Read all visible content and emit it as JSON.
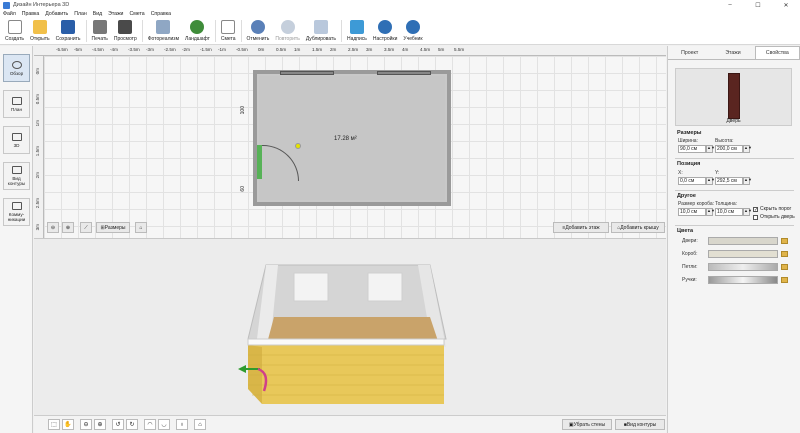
{
  "window": {
    "title": "Дизайн Интерьера 3D",
    "min": "–",
    "max": "☐",
    "close": "✕"
  },
  "menu": [
    "Файл",
    "Правка",
    "Добавить",
    "План",
    "Вид",
    "Этажи",
    "Смета",
    "Справка"
  ],
  "toolbar": {
    "create": "Создать",
    "open": "Открыть",
    "save": "Сохранить",
    "print": "Печать",
    "preview": "Просмотр",
    "photo": "Фотореализм",
    "landscape": "Ландшафт",
    "estimate": "Смета",
    "undo": "Отменить",
    "redo": "Повторить",
    "duplicate": "Дублировать",
    "labels": "Надпись",
    "settings": "Настройки",
    "tutorial": "Учебник"
  },
  "left_nav": {
    "overview": "Обзор",
    "plan": "План",
    "view3d": "3D",
    "outline": "Вид контуры",
    "comm": "Комму-никации"
  },
  "ruler": {
    "top": [
      "-5.5m",
      "-5m",
      "-4.5m",
      "-4m",
      "-3.5m",
      "-3m",
      "-2.5m",
      "-2m",
      "-1.5m",
      "-1m",
      "-0.5m",
      "0m",
      "0.5m",
      "1m",
      "1.5m",
      "2m",
      "2.5m",
      "3m",
      "3.5m",
      "4m",
      "4.5m",
      "5m",
      "5.5m"
    ],
    "left": [
      "0m",
      "0.5m",
      "1m",
      "1.5m",
      "2m",
      "2.5m",
      "3m"
    ]
  },
  "plan": {
    "area": "17.28 м²",
    "dim_top": "100",
    "dim_bottom": "60",
    "dims_label": "Размеры",
    "add_floor": "Добавить этаж",
    "add_roof": "Добавить крышу"
  },
  "bottom": {
    "hide_walls": "Убрать стены",
    "outline_view": "Вид контуры"
  },
  "panel": {
    "tabs": [
      "Проект",
      "Этажи",
      "Свойства"
    ],
    "active_tab": "Свойства",
    "item_name": "Дверь",
    "sizes_title": "Размеры",
    "width_label": "Ширина:",
    "width_value": "90,0 см",
    "height_label": "Высота:",
    "height_value": "200,0 см",
    "position_title": "Позиция",
    "x_label": "X:",
    "x_value": "0,0 см",
    "y_label": "Y:",
    "y_value": "292,5 см",
    "other_title": "Другое",
    "frame_label": "Размер короба:",
    "frame_value": "10,0 см",
    "thickness_label": "Толщина:",
    "thickness_value": "10,0 см",
    "hide_threshold": "Скрыть порог",
    "open_door": "Открыть дверь",
    "colors_title": "Цвета",
    "doors_label": "Двери:",
    "box_label": "Короб:",
    "hinges_label": "Петли:",
    "handles_label": "Ручки:"
  },
  "colors": {
    "accent": "#0078d7",
    "door": "#5a2520",
    "wall_brick": "#e8c85a",
    "floor": "#c9a36a"
  }
}
